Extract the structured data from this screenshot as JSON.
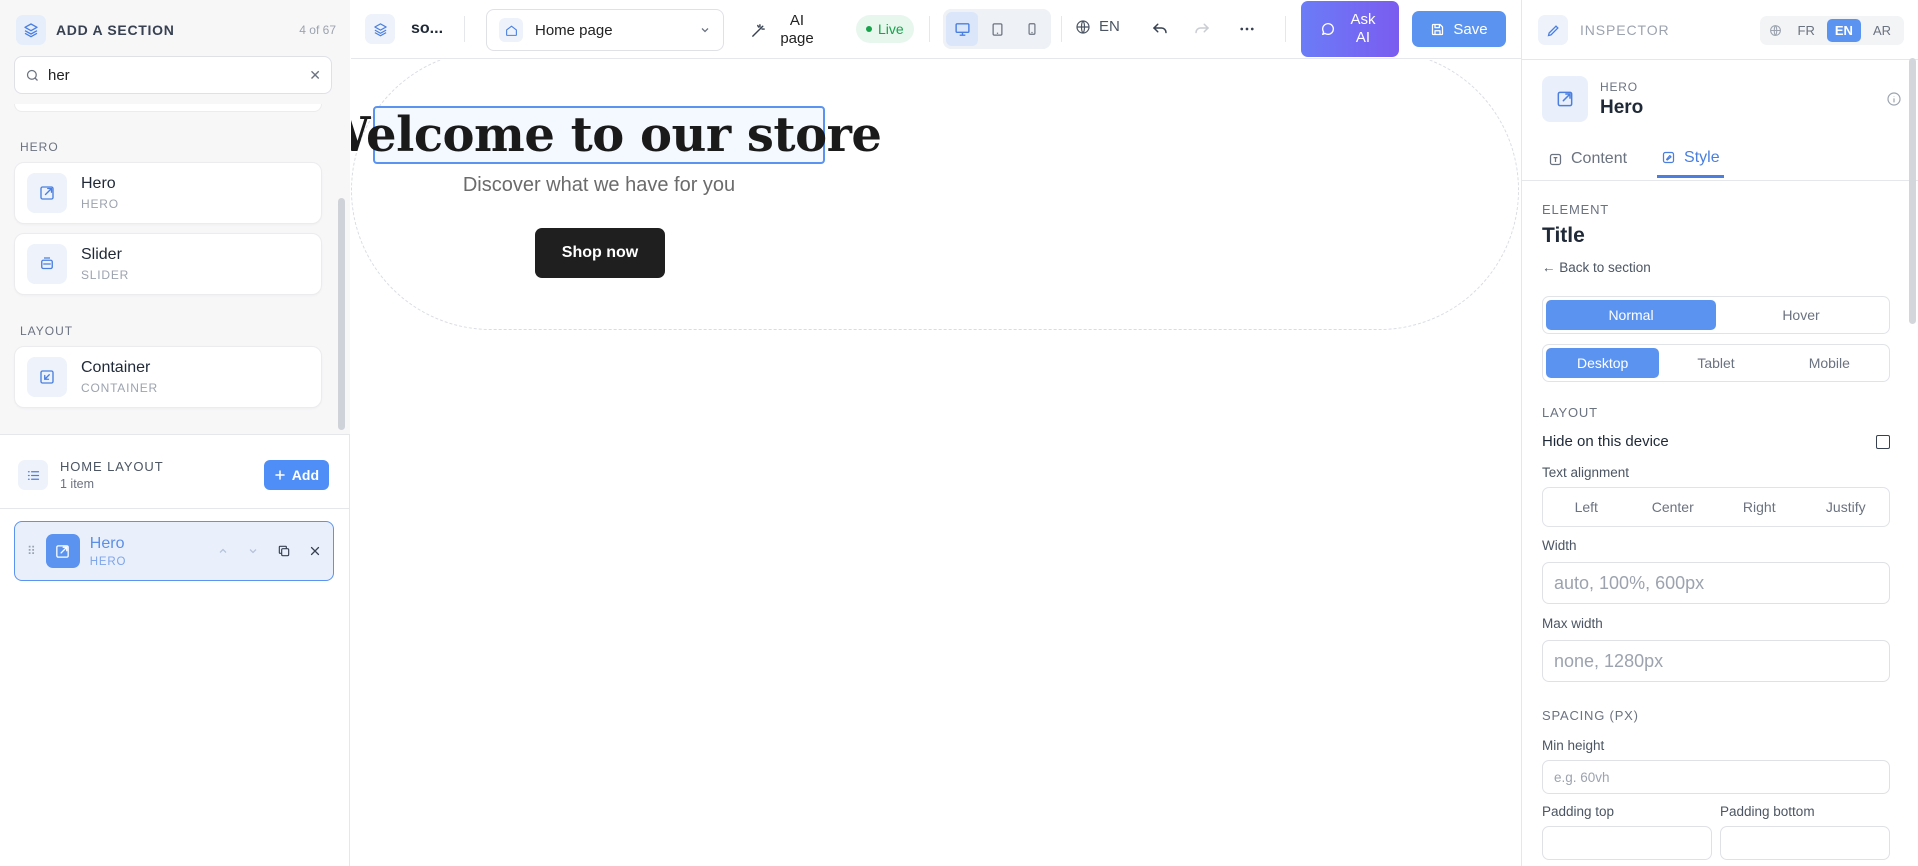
{
  "left_panel": {
    "title": "ADD A SECTION",
    "count": "4 of 67",
    "search": {
      "value": "her",
      "placeholder": ""
    },
    "groups": [
      {
        "label": "HERO",
        "items": [
          {
            "name": "Hero",
            "sub": "HERO",
            "icon": "external-link-icon"
          },
          {
            "name": "Slider",
            "sub": "SLIDER",
            "icon": "slides-icon"
          }
        ]
      },
      {
        "label": "LAYOUT",
        "items": [
          {
            "name": "Container",
            "sub": "CONTAINER",
            "icon": "collapse-icon"
          }
        ]
      }
    ],
    "home_layout": {
      "title": "HOME LAYOUT",
      "subtitle": "1 item",
      "add_label": "Add"
    },
    "layout_items": [
      {
        "name": "Hero",
        "sub": "HERO"
      }
    ]
  },
  "topbar": {
    "site_name": "so...",
    "page_select": "Home page",
    "ai_page_label": "AI page",
    "status": "Live",
    "language": "EN",
    "ask_ai_label": "Ask AI",
    "save_label": "Save"
  },
  "canvas": {
    "hero_title": "Welcome to our store",
    "hero_subtitle": "Discover what we have for you",
    "hero_button": "Shop now"
  },
  "inspector": {
    "title": "INSPECTOR",
    "languages": [
      "FR",
      "EN",
      "AR"
    ],
    "active_language": "EN",
    "section_kind": "HERO",
    "section_name": "Hero",
    "tabs": [
      "Content",
      "Style"
    ],
    "active_tab": "Style",
    "element_label": "ELEMENT",
    "element_name": "Title",
    "back_link": "← Back to section",
    "state_options": [
      "Normal",
      "Hover"
    ],
    "device_options": [
      "Desktop",
      "Tablet",
      "Mobile"
    ],
    "layout_label": "LAYOUT",
    "hide_on_device": "Hide on this device",
    "text_alignment_label": "Text alignment",
    "alignment_options": [
      "Left",
      "Center",
      "Right",
      "Justify"
    ],
    "width_label": "Width",
    "width_placeholder": "auto, 100%, 600px",
    "max_width_label": "Max width",
    "max_width_placeholder": "none, 1280px",
    "spacing_label": "SPACING (PX)",
    "min_height_label": "Min height",
    "min_height_placeholder": "e.g. 60vh",
    "padding_top_label": "Padding top",
    "padding_bottom_label": "Padding bottom"
  },
  "colors": {
    "accent": "#5b93f0",
    "live": "#16a34a",
    "ask_ai_gradient_start": "#6b7cf7",
    "ask_ai_gradient_end": "#7a5cf0"
  }
}
